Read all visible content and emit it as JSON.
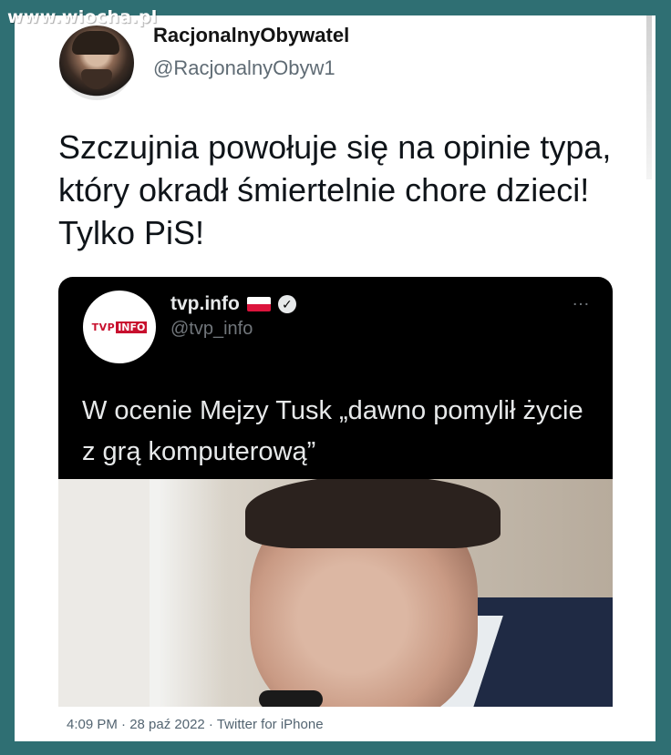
{
  "watermark": "www.wiocha.pl",
  "tweet": {
    "author_name": "RacjonalnyObywatel",
    "author_handle": "@RacjonalnyObyw1",
    "text": "Szczujnia powołuje się na opinie typa, który okradł śmiertelnie chore dzieci!  Tylko PiS!"
  },
  "quoted_tweet": {
    "author_name": "tvp.info",
    "author_handle": "@tvp_info",
    "logo_text_tvp": "TVP",
    "logo_text_info": "INFO",
    "text": "W ocenie Mejzy Tusk „dawno pomylił życie z grą komputerową”",
    "more_icon": "…",
    "verified_icon": "✓"
  },
  "footer": {
    "meta": "4:09 PM · 28 paź 2022 · Twitter for iPhone"
  },
  "colors": {
    "background": "#2f6f73",
    "card": "#ffffff",
    "quote_bg": "#000000",
    "flag_red": "#dc143c"
  }
}
